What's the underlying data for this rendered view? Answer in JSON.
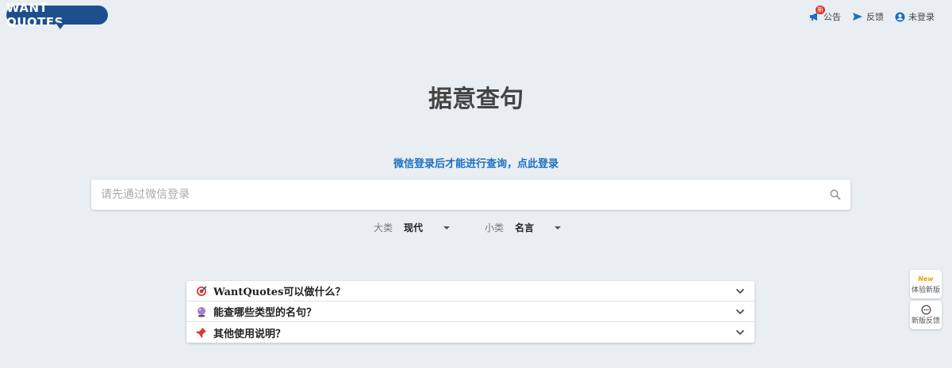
{
  "header": {
    "logo_text": "WANT QUOTES",
    "nav": {
      "announce_label": "公告",
      "announce_badge": "新",
      "feedback_label": "反馈",
      "login_label": "未登录"
    }
  },
  "main": {
    "title": "据意查句",
    "login_hint": "微信登录后才能进行查询，点此登录",
    "search_placeholder": "请先通过微信登录"
  },
  "filters": {
    "category_label": "大类",
    "category_value": "现代",
    "subcategory_label": "小类",
    "subcategory_value": "名言"
  },
  "faq": {
    "items": [
      {
        "icon": "target-icon",
        "text": "WantQuotes可以做什么？"
      },
      {
        "icon": "crystal-ball-icon",
        "text": "能查哪些类型的名句？"
      },
      {
        "icon": "pushpin-icon",
        "text": "其他使用说明？"
      }
    ]
  },
  "floating": {
    "new_tag": "New",
    "try_new_label": "体验新版",
    "new_feedback_label": "新版反馈"
  },
  "colors": {
    "accent": "#1e6fbf",
    "logo_bg": "#1d4f8f",
    "background": "#e9eef2"
  }
}
